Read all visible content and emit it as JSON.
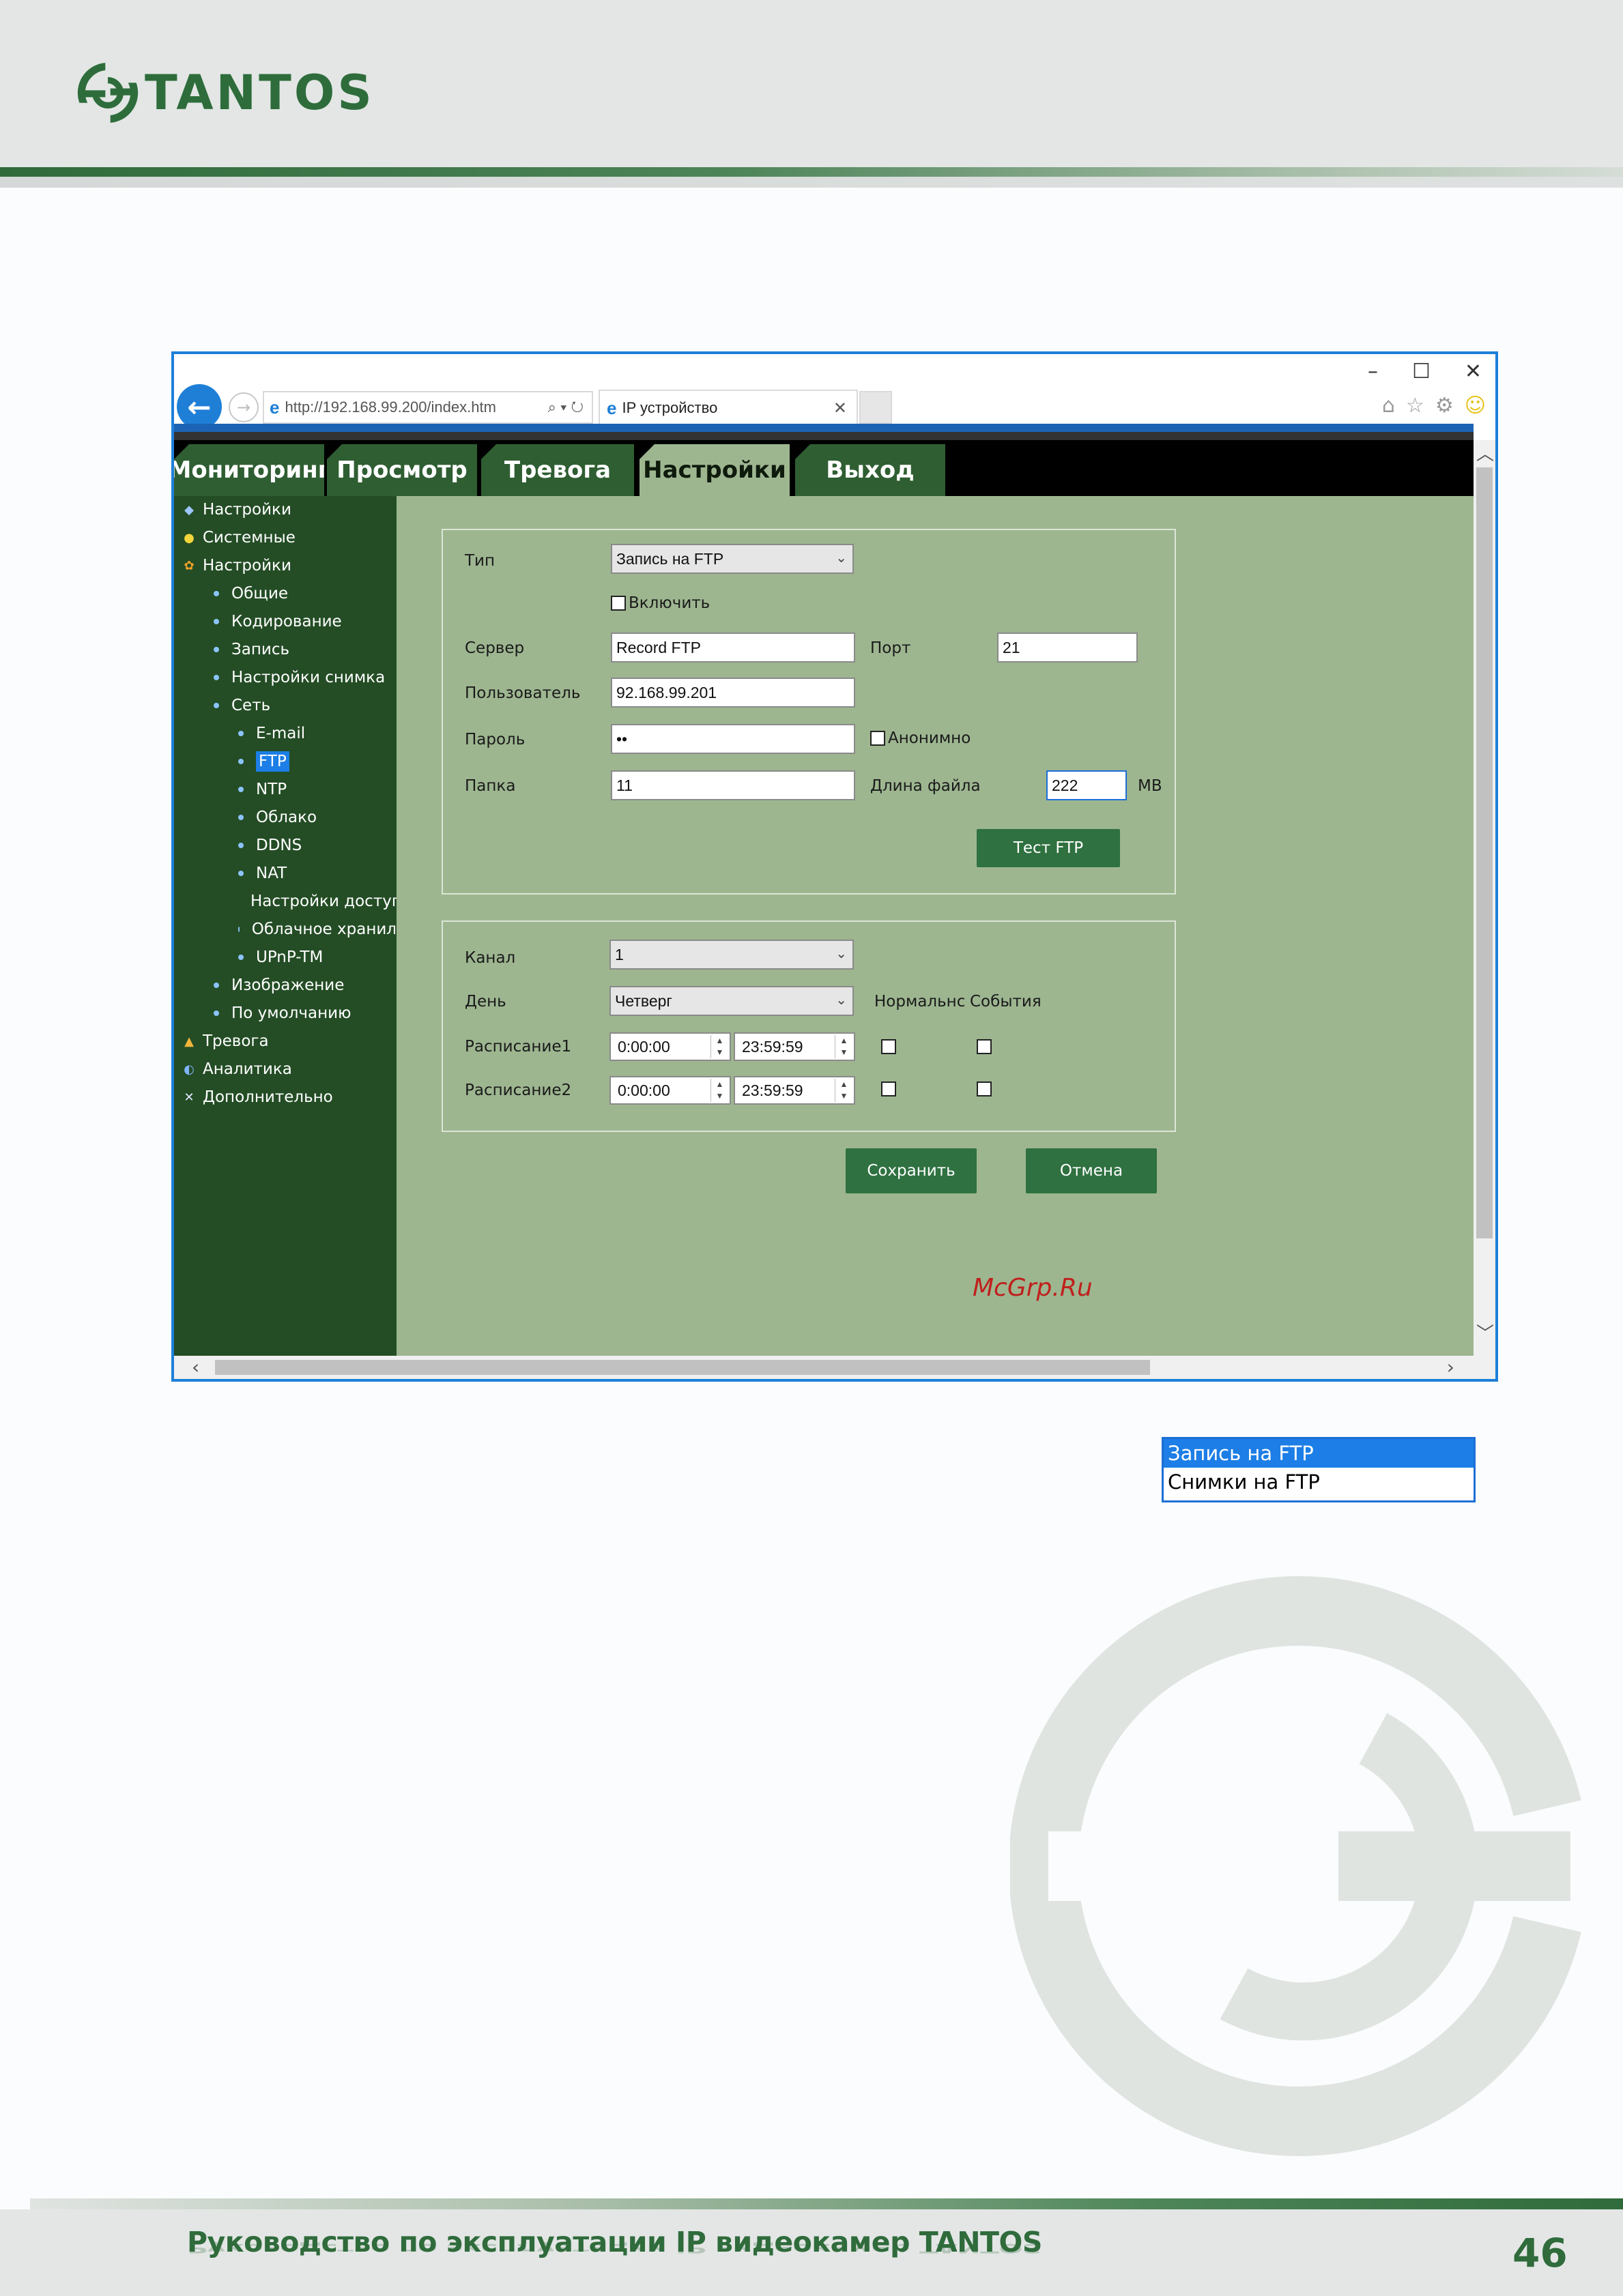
{
  "brand": {
    "name": "TANTOS"
  },
  "browser": {
    "url": "http://192.168.99.200/index.htm",
    "tab_title": "IP устройство",
    "win_minimize": "–",
    "win_maximize": "☐",
    "win_close": "✕"
  },
  "nav": {
    "tabs": [
      {
        "label": "Мониторинг"
      },
      {
        "label": "Просмотр"
      },
      {
        "label": "Тревога"
      },
      {
        "label": "Настройки"
      },
      {
        "label": "Выход"
      }
    ],
    "active": "Настройки"
  },
  "sidebar": {
    "items": [
      {
        "label": "Настройки"
      },
      {
        "label": "Системные"
      },
      {
        "label": "Настройки"
      },
      {
        "label": "Общие"
      },
      {
        "label": "Кодирование"
      },
      {
        "label": "Запись"
      },
      {
        "label": "Настройки снимка"
      },
      {
        "label": "Сеть"
      },
      {
        "label": "E-mail"
      },
      {
        "label": "FTP"
      },
      {
        "label": "NTP"
      },
      {
        "label": "Облако"
      },
      {
        "label": "DDNS"
      },
      {
        "label": "NAT"
      },
      {
        "label": "Настройки доступ"
      },
      {
        "label": "Облачное хранил"
      },
      {
        "label": "UPnP-TM"
      },
      {
        "label": "Изображение"
      },
      {
        "label": "По умолчанию"
      },
      {
        "label": "Тревога"
      },
      {
        "label": "Аналитика"
      },
      {
        "label": "Дополнительно"
      }
    ],
    "selected": "FTP"
  },
  "ftp_form": {
    "type_label": "Тип",
    "type_value": "Запись на FTP",
    "enable_label": "Включить",
    "server_label": "Сервер",
    "server_value": "Record FTP",
    "port_label": "Порт",
    "port_value": "21",
    "user_label": "Пользователь",
    "user_value": "92.168.99.201",
    "password_label": "Пароль",
    "password_value": "••",
    "anonymous_label": "Анонимно",
    "folder_label": "Папка",
    "folder_value": "11",
    "file_length_label": "Длина файла",
    "file_length_value": "222",
    "file_length_unit": "MB",
    "test_button": "Тест FTP"
  },
  "schedule": {
    "channel_label": "Канал",
    "channel_value": "1",
    "day_label": "День",
    "day_value": "Четверг",
    "normal_header": "Нормальнс",
    "events_header": "События",
    "rows": [
      {
        "label": "Расписание1",
        "start": "0:00:00",
        "end": "23:59:59"
      },
      {
        "label": "Расписание2",
        "start": "0:00:00",
        "end": "23:59:59"
      }
    ]
  },
  "actions": {
    "save": "Сохранить",
    "cancel": "Отмена"
  },
  "overlay_watermark": "McGrp.Ru",
  "dropdown": {
    "options": [
      "Запись на FTP",
      "Снимки на FTP"
    ],
    "selected": "Запись на FTP"
  },
  "footer": {
    "title": "Руководство по эксплуатации IP видеокамер TANTOS",
    "page_number": "46"
  },
  "colors": {
    "brand_green": "#2e6d3b",
    "sidebar_bg": "#244d25",
    "content_bg": "#9db690",
    "nav_tab_bg": "#2f5e32",
    "selection_blue": "#1c7ee6"
  }
}
